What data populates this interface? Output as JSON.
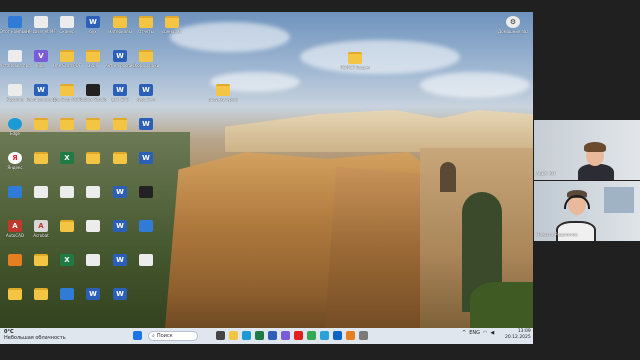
{
  "desktop": {
    "icons": [
      {
        "label": "Этот компьютер",
        "icon": "computer-icon",
        "kind": "app-blue",
        "col": 0,
        "row": 0
      },
      {
        "label": "HP LaserJet MFP M125",
        "icon": "printer-icon",
        "kind": "app-white",
        "col": 1,
        "row": 0
      },
      {
        "label": "Сканер",
        "icon": "scanner-icon",
        "kind": "app-white",
        "col": 2,
        "row": 0
      },
      {
        "label": "бух",
        "icon": "word-icon",
        "kind": "word",
        "col": 3,
        "row": 0
      },
      {
        "label": "материалы",
        "icon": "folder-icon",
        "kind": "folder",
        "col": 4,
        "row": 0
      },
      {
        "label": "Отчеты",
        "icon": "folder-icon",
        "kind": "folder",
        "col": 5,
        "row": 0
      },
      {
        "label": "сценарии",
        "icon": "folder-icon",
        "kind": "folder",
        "col": 6,
        "row": 0
      },
      {
        "label": "Установка программ",
        "icon": "installer-icon",
        "kind": "app-white",
        "col": 0,
        "row": 1
      },
      {
        "label": "Viber",
        "icon": "viber-icon",
        "kind": "app-purple",
        "col": 1,
        "row": 1
      },
      {
        "label": "One Scan PDF",
        "icon": "folder-icon",
        "kind": "folder",
        "col": 2,
        "row": 1
      },
      {
        "label": "3,5,6",
        "icon": "folder-icon",
        "kind": "folder",
        "col": 3,
        "row": 1
      },
      {
        "label": "Акт на расписание",
        "icon": "word-icon",
        "kind": "word",
        "col": 4,
        "row": 1
      },
      {
        "label": "сборы уроки",
        "icon": "folder-icon",
        "kind": "folder",
        "col": 5,
        "row": 1
      },
      {
        "label": "Корзина",
        "icon": "recycle-bin-icon",
        "kind": "app-white",
        "col": 0,
        "row": 2
      },
      {
        "label": "Расписание уроков",
        "icon": "word-icon",
        "kind": "word",
        "col": 1,
        "row": 2
      },
      {
        "label": "One Scan PDF Scanner",
        "icon": "folder-icon",
        "kind": "folder",
        "col": 2,
        "row": 2
      },
      {
        "label": "Roblox Studio",
        "icon": "roblox-icon",
        "kind": "app-dark",
        "col": 3,
        "row": 2
      },
      {
        "label": "Д.З. ЕГЭ",
        "icon": "word-icon",
        "kind": "word",
        "col": 4,
        "row": 2
      },
      {
        "label": "курс 5 кл",
        "icon": "word-icon",
        "kind": "word",
        "col": 5,
        "row": 2
      },
      {
        "label": "Edge",
        "icon": "edge-icon",
        "kind": "app-edge",
        "col": 0,
        "row": 3
      },
      {
        "label": "",
        "icon": "folder-icon",
        "kind": "folder",
        "col": 1,
        "row": 3
      },
      {
        "label": "",
        "icon": "folder-icon",
        "kind": "folder",
        "col": 2,
        "row": 3
      },
      {
        "label": "",
        "icon": "folder-icon",
        "kind": "folder",
        "col": 3,
        "row": 3
      },
      {
        "label": "",
        "icon": "folder-icon",
        "kind": "folder",
        "col": 4,
        "row": 3
      },
      {
        "label": "",
        "icon": "word-icon",
        "kind": "word",
        "col": 5,
        "row": 3
      },
      {
        "label": "Яндекс",
        "icon": "yandex-icon",
        "kind": "app-yandex",
        "col": 0,
        "row": 4
      },
      {
        "label": "",
        "icon": "folder-icon",
        "kind": "folder",
        "col": 1,
        "row": 4
      },
      {
        "label": "",
        "icon": "excel-icon",
        "kind": "excel",
        "col": 2,
        "row": 4
      },
      {
        "label": "",
        "icon": "folder-icon",
        "kind": "folder",
        "col": 3,
        "row": 4
      },
      {
        "label": "",
        "icon": "folder-icon",
        "kind": "folder",
        "col": 4,
        "row": 4
      },
      {
        "label": "",
        "icon": "word-icon",
        "kind": "word",
        "col": 5,
        "row": 4
      },
      {
        "label": "",
        "icon": "app-icon",
        "kind": "app-blue",
        "col": 0,
        "row": 5
      },
      {
        "label": "",
        "icon": "document-icon",
        "kind": "app-white",
        "col": 1,
        "row": 5
      },
      {
        "label": "",
        "icon": "document-icon",
        "kind": "app-white",
        "col": 2,
        "row": 5
      },
      {
        "label": "",
        "icon": "document-icon",
        "kind": "app-white",
        "col": 3,
        "row": 5
      },
      {
        "label": "",
        "icon": "word-icon",
        "kind": "word",
        "col": 4,
        "row": 5
      },
      {
        "label": "",
        "icon": "app-icon",
        "kind": "app-dark",
        "col": 5,
        "row": 5
      },
      {
        "label": "AutoCAD",
        "icon": "autocad-icon",
        "kind": "app-red",
        "col": 0,
        "row": 6
      },
      {
        "label": "Acrobat",
        "icon": "pdf-icon",
        "kind": "pdf",
        "col": 1,
        "row": 6
      },
      {
        "label": "",
        "icon": "folder-icon",
        "kind": "folder",
        "col": 2,
        "row": 6
      },
      {
        "label": "",
        "icon": "document-icon",
        "kind": "app-white",
        "col": 3,
        "row": 6
      },
      {
        "label": "",
        "icon": "word-icon",
        "kind": "word",
        "col": 4,
        "row": 6
      },
      {
        "label": "",
        "icon": "app-icon",
        "kind": "app-blue",
        "col": 5,
        "row": 6
      },
      {
        "label": "",
        "icon": "app-icon",
        "kind": "app-orange",
        "col": 0,
        "row": 7
      },
      {
        "label": "",
        "icon": "folder-icon",
        "kind": "folder",
        "col": 1,
        "row": 7
      },
      {
        "label": "",
        "icon": "excel-icon",
        "kind": "excel",
        "col": 2,
        "row": 7
      },
      {
        "label": "",
        "icon": "document-icon",
        "kind": "app-white",
        "col": 3,
        "row": 7
      },
      {
        "label": "",
        "icon": "word-icon",
        "kind": "word",
        "col": 4,
        "row": 7
      },
      {
        "label": "",
        "icon": "document-icon",
        "kind": "app-white",
        "col": 5,
        "row": 7
      },
      {
        "label": "",
        "icon": "folder-icon",
        "kind": "folder",
        "col": 0,
        "row": 8
      },
      {
        "label": "",
        "icon": "folder-icon",
        "kind": "folder",
        "col": 1,
        "row": 8
      },
      {
        "label": "",
        "icon": "app-icon",
        "kind": "app-blue",
        "col": 2,
        "row": 8
      },
      {
        "label": "",
        "icon": "word-icon",
        "kind": "word",
        "col": 3,
        "row": 8
      },
      {
        "label": "",
        "icon": "word-icon",
        "kind": "word",
        "col": 4,
        "row": 8
      }
    ],
    "extra_icons": [
      {
        "label": "ПОИСК Бюджет 2025",
        "icon": "folder-icon",
        "kind": "folder"
      },
      {
        "label": "рисунки уроки",
        "icon": "folder-icon",
        "kind": "folder"
      },
      {
        "label": "Домашние задания",
        "icon": "gear-icon",
        "kind": "app-white"
      }
    ]
  },
  "taskbar": {
    "weather_temp": "0°C",
    "weather_desc": "Небольшая облачность",
    "search_placeholder": "Поиск",
    "lang": "ENG",
    "time": "13:09",
    "date": "20.12.2025",
    "apps": [
      {
        "icon": "start-icon",
        "color": "#1a73e8"
      },
      {
        "icon": "task-view-icon",
        "color": "#444444"
      },
      {
        "icon": "explorer-icon",
        "color": "#f4c542"
      },
      {
        "icon": "edge-icon",
        "color": "#1c9ad6"
      },
      {
        "icon": "excel-icon",
        "color": "#1f7a44"
      },
      {
        "icon": "word-icon",
        "color": "#2b5fb8"
      },
      {
        "icon": "viber-icon",
        "color": "#7b5bd6"
      },
      {
        "icon": "yandex-icon",
        "color": "#e02020"
      },
      {
        "icon": "chrome-icon",
        "color": "#34a853"
      },
      {
        "icon": "telegram-icon",
        "color": "#2aa1da"
      },
      {
        "icon": "mail-icon",
        "color": "#0b63c5"
      },
      {
        "icon": "app-icon",
        "color": "#e67e22"
      },
      {
        "icon": "app-icon",
        "color": "#7a7a7a"
      }
    ]
  },
  "participants": [
    {
      "name": "ALEX KH"
    },
    {
      "name": "Никита Родионов"
    }
  ]
}
